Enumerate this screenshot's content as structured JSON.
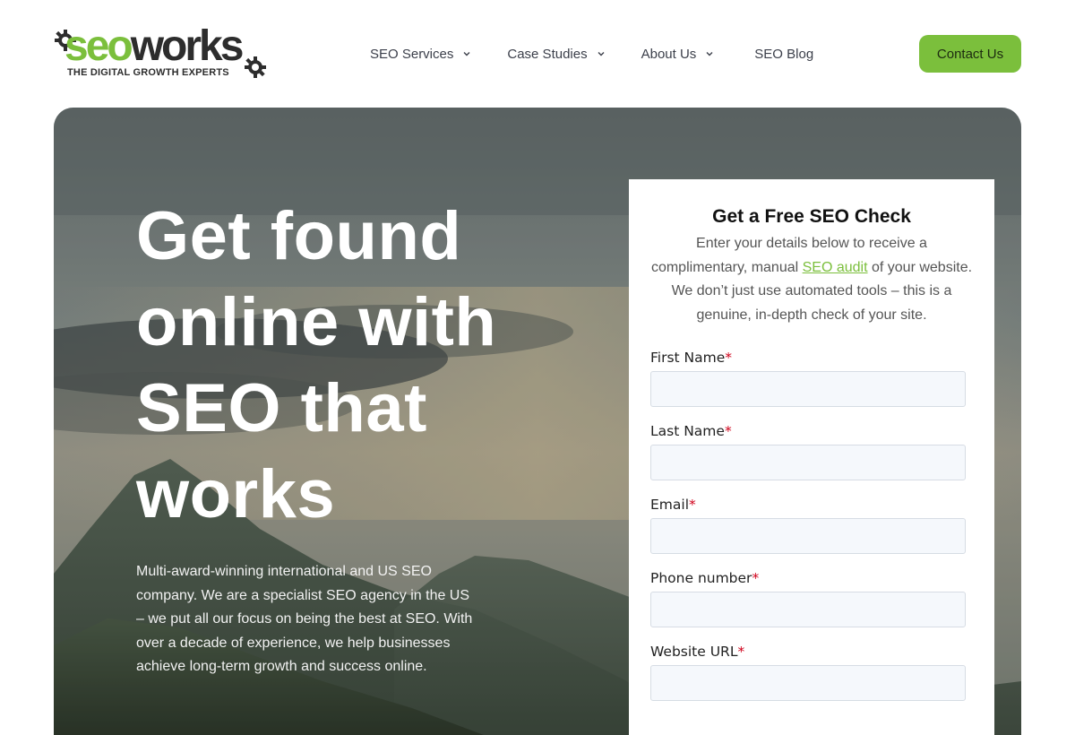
{
  "brand": {
    "logo_seo": "seo",
    "logo_works": "works",
    "tagline": "THE DIGITAL GROWTH EXPERTS",
    "colors": {
      "green": "#7bbf3c",
      "dark": "#2d2d2d"
    }
  },
  "nav": {
    "items": [
      {
        "label": "SEO Services",
        "has_dropdown": true
      },
      {
        "label": "Case Studies",
        "has_dropdown": true
      },
      {
        "label": "About Us",
        "has_dropdown": true
      },
      {
        "label": "SEO Blog",
        "has_dropdown": false
      }
    ],
    "cta_label": "Contact Us"
  },
  "hero": {
    "headline_lines": [
      "Get found",
      "online with",
      "SEO that",
      "works"
    ],
    "description": "Multi-award-winning international and US SEO company. We are a specialist SEO agency in the US – we put all our focus on being the best at SEO. With over a decade of experience, we help businesses achieve long-term growth and success online."
  },
  "form": {
    "title": "Get a Free SEO Check",
    "intro_before": "Enter your details below to receive a complimentary, manual ",
    "intro_link": "SEO audit",
    "intro_after": " of your website. We don’t just use automated tools – this is a genuine, in-depth check of your site.",
    "required_mark": "*",
    "fields": [
      {
        "label": "First Name",
        "value": ""
      },
      {
        "label": "Last Name",
        "value": ""
      },
      {
        "label": "Email",
        "value": ""
      },
      {
        "label": "Phone number",
        "value": ""
      },
      {
        "label": "Website URL",
        "value": ""
      }
    ]
  },
  "icons": [
    "gear-icon",
    "chevron-down-icon"
  ]
}
